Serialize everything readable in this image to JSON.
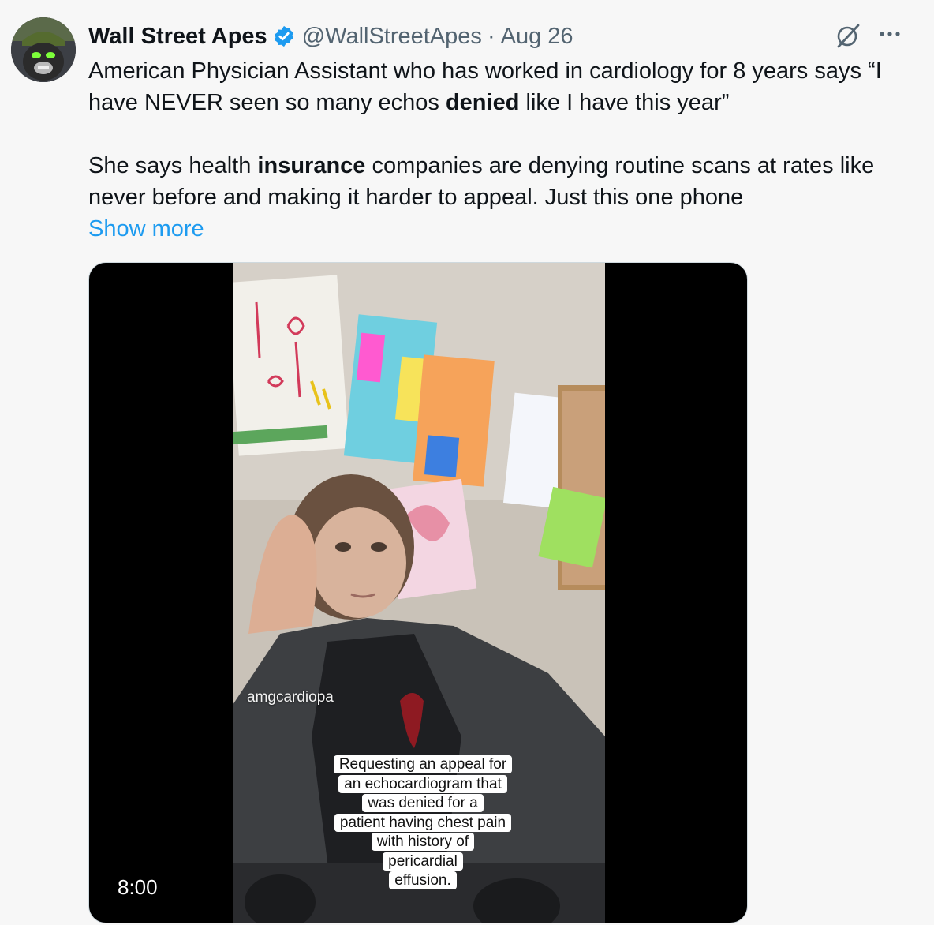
{
  "author": {
    "name": "Wall Street Apes",
    "handle": "@WallStreetApes",
    "separator": "·",
    "date": "Aug 26"
  },
  "icons": {
    "verified": "verified-badge-icon",
    "grok": "grok-icon",
    "more": "more-options-icon"
  },
  "colors": {
    "verified": "#1d9bf0",
    "link": "#1d9bf0",
    "secondary_text": "#536471"
  },
  "post": {
    "p1_part1": "American Physician Assistant who has worked in cardiology for 8 years says “I have NEVER seen so many echos ",
    "p1_bold": "denied",
    "p1_part2": " like I have this year”",
    "p2_part1": "She says health ",
    "p2_bold": "insurance",
    "p2_part2": " companies are denying routine scans at rates like never before and making it harder to appeal. Just this one phone",
    "show_more": "Show more"
  },
  "video": {
    "username_overlay": "amgcardiopa",
    "caption_lines": [
      "Requesting an appeal for",
      "an echocardiogram that",
      "was denied for a",
      "patient having chest pain",
      "with history of",
      "pericardial",
      "effusion."
    ],
    "duration": "8:00"
  }
}
